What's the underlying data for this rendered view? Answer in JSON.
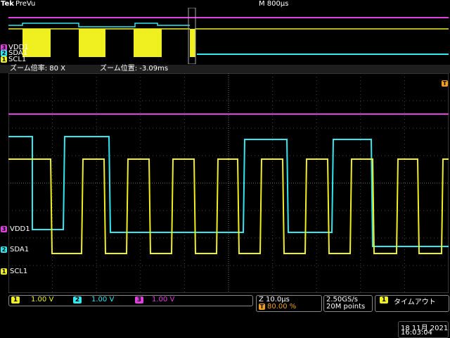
{
  "header": {
    "logo": "Tek",
    "mode": "PreVu",
    "timebase": "M 800μs"
  },
  "zoom": {
    "factor": "ズーム倍率: 80 X",
    "position": "ズーム位置: -3.09ms"
  },
  "channels": {
    "vdd1": {
      "num": "3",
      "label": "VDD1",
      "scale": "1.00 V",
      "color": "#e040e0"
    },
    "sda1": {
      "num": "2",
      "label": "SDA1",
      "scale": "1.00 V",
      "color": "#30e8f0"
    },
    "scl1": {
      "num": "1",
      "label": "SCL1",
      "scale": "1.00 V",
      "color": "#f0f020"
    }
  },
  "trigger_marker": "T",
  "horizontal": {
    "zoom_scale": "Z 10.0μs",
    "trigger_pos": "80.00 %"
  },
  "acquisition": {
    "sample_rate": "2.50GS/s",
    "record_length": "20M points"
  },
  "trigger": {
    "num": "1",
    "label": "タイムアウト"
  },
  "datetime": {
    "date": "18 11月 2021",
    "time": "16:03:04"
  },
  "colors": {
    "vdd": "#e040e0",
    "sda": "#30e8f0",
    "scl": "#f0f020",
    "trigger": "#f0a020"
  }
}
